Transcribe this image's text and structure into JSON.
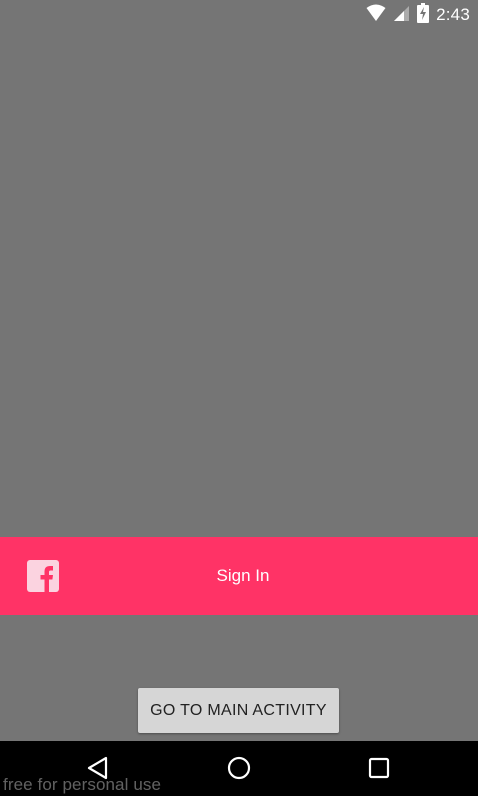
{
  "status_bar": {
    "time": "2:43",
    "icons": [
      "wifi-icon",
      "cell-signal-icon",
      "battery-charging-icon"
    ]
  },
  "screen": {
    "background_color": "#757575"
  },
  "signin": {
    "label": "Sign In",
    "icon": "facebook-icon",
    "color": "#ff3366",
    "icon_color": "#fbd3e0"
  },
  "main_button": {
    "label": "GO TO MAIN ACTIVITY",
    "background": "#d6d6d6",
    "text_color": "#222222"
  },
  "nav_bar": {
    "background": "#000000",
    "buttons": [
      "back-icon",
      "home-icon",
      "recents-icon"
    ]
  },
  "watermark": {
    "text": "free for personal use"
  }
}
